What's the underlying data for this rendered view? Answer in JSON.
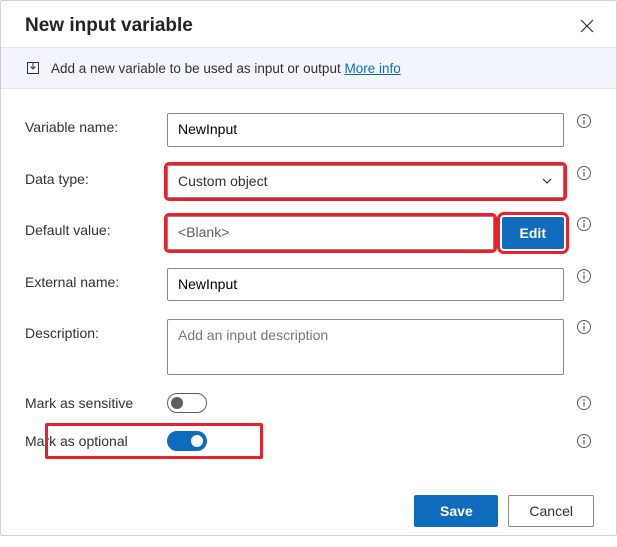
{
  "dialog": {
    "title": "New input variable",
    "info_text": "Add a new variable to be used as input or output",
    "info_link": "More info"
  },
  "fields": {
    "variable_name": {
      "label": "Variable name:",
      "value": "NewInput"
    },
    "data_type": {
      "label": "Data type:",
      "value": "Custom object"
    },
    "default_value": {
      "label": "Default value:",
      "value": "<Blank>",
      "edit_label": "Edit"
    },
    "external_name": {
      "label": "External name:",
      "value": "NewInput"
    },
    "description": {
      "label": "Description:",
      "placeholder": "Add an input description"
    },
    "mark_sensitive": {
      "label": "Mark as sensitive",
      "value": false
    },
    "mark_optional": {
      "label": "Mark as optional",
      "value": true
    }
  },
  "footer": {
    "save": "Save",
    "cancel": "Cancel"
  },
  "icons": {
    "close": "close-icon",
    "download": "variable-icon",
    "info": "info-icon",
    "chevron": "chevron-down-icon"
  }
}
